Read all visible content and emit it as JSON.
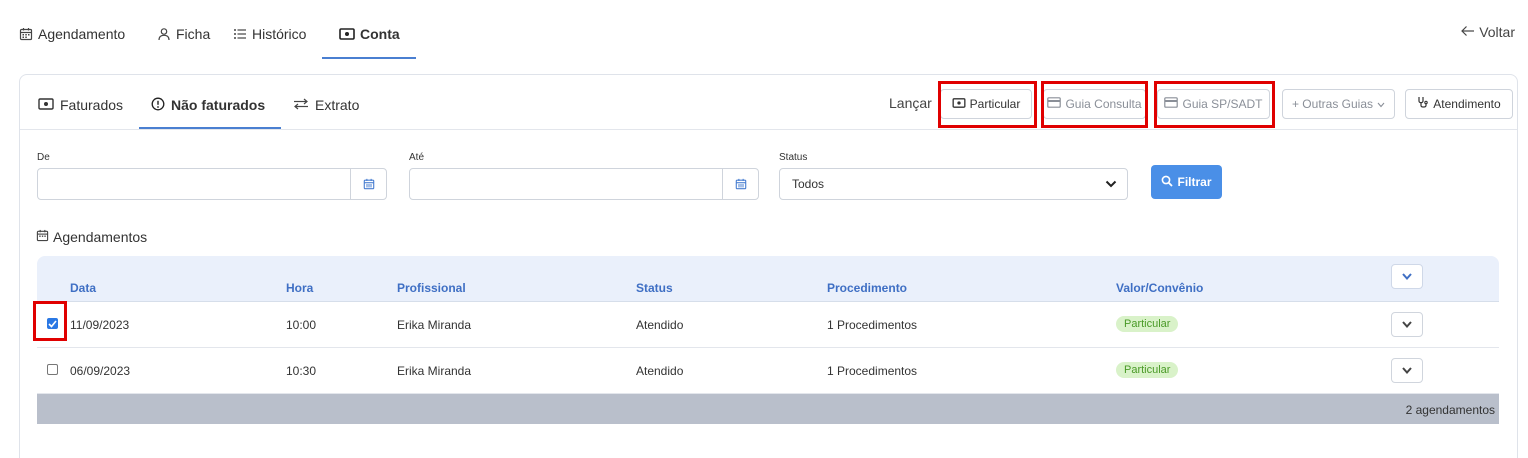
{
  "top_nav": {
    "tabs": [
      {
        "label": "Agendamento",
        "icon": "calendar-icon"
      },
      {
        "label": "Ficha",
        "icon": "user-icon"
      },
      {
        "label": "Histórico",
        "icon": "list-icon"
      },
      {
        "label": "Conta",
        "icon": "money-icon",
        "active": true
      }
    ],
    "back_label": "Voltar"
  },
  "sub_nav": {
    "tabs": [
      {
        "label": "Faturados",
        "icon": "money-icon"
      },
      {
        "label": "Não faturados",
        "icon": "alert-circle-icon",
        "active": true
      },
      {
        "label": "Extrato",
        "icon": "swap-icon"
      }
    ],
    "lancar_label": "Lançar",
    "actions": [
      {
        "label": "Particular",
        "icon": "money-icon"
      },
      {
        "label": "Guia Consulta",
        "icon": "card-icon"
      },
      {
        "label": "Guia SP/SADT",
        "icon": "card-icon"
      },
      {
        "label": "+ Outras Guias",
        "icon": "chevron-down-icon"
      },
      {
        "label": "Atendimento",
        "icon": "stethoscope-icon"
      }
    ]
  },
  "filters": {
    "de_label": "De",
    "de_value": "",
    "ate_label": "Até",
    "ate_value": "",
    "status_label": "Status",
    "status_value": "Todos",
    "filter_button": "Filtrar"
  },
  "section_title": "Agendamentos",
  "table": {
    "columns": [
      "Data",
      "Hora",
      "Profissional",
      "Status",
      "Procedimento",
      "Valor/Convênio"
    ],
    "rows": [
      {
        "checked": true,
        "data": "11/09/2023",
        "hora": "10:00",
        "profissional": "Erika Miranda",
        "status": "Atendido",
        "procedimento": "1 Procedimentos",
        "valor": "Particular"
      },
      {
        "checked": false,
        "data": "06/09/2023",
        "hora": "10:30",
        "profissional": "Erika Miranda",
        "status": "Atendido",
        "procedimento": "1 Procedimentos",
        "valor": "Particular"
      }
    ],
    "footer": "2 agendamentos"
  },
  "colors": {
    "accent": "#4a7fd1",
    "primary_button": "#4a8fe7",
    "highlight_box": "#e00000",
    "badge_bg": "#d9f2c9",
    "badge_text": "#4a9a27",
    "table_header_bg": "#eaf0fb",
    "table_footer_bg": "#b9bfcb"
  }
}
